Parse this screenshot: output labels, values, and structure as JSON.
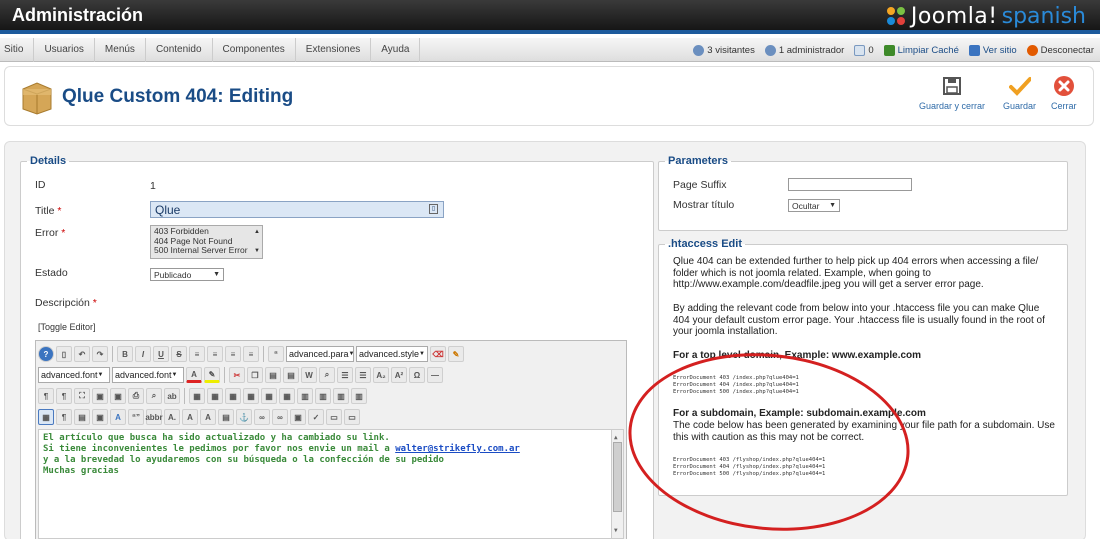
{
  "header": {
    "admin_title": "Administración",
    "logo_word": "Joomla!",
    "logo_sub": "spanish"
  },
  "menu": {
    "items": [
      "Sitio",
      "Usuarios",
      "Menús",
      "Contenido",
      "Componentes",
      "Extensiones",
      "Ayuda"
    ]
  },
  "status": {
    "visitors": "3 visitantes",
    "admins": "1 administrador",
    "messages": "0",
    "clear_cache": "Limpiar Caché",
    "view_site": "Ver sitio",
    "logout": "Desconectar"
  },
  "toolbar": {
    "page_title": "Qlue Custom 404: Editing",
    "save_close": "Guardar y cerrar",
    "save": "Guardar",
    "close": "Cerrar"
  },
  "details": {
    "legend": "Details",
    "id_label": "ID",
    "id_value": "1",
    "title_label": "Title",
    "title_value": "Qlue",
    "error_label": "Error",
    "error_options": [
      "403 Forbidden",
      "404 Page Not Found",
      "500 Internal Server Error"
    ],
    "estado_label": "Estado",
    "estado_value": "Publicado",
    "descripcion_label": "Descripción",
    "toggle_editor": "[Toggle Editor]",
    "required_mark": "*"
  },
  "editor": {
    "select_paragraph": "advanced.para",
    "select_style": "advanced.style",
    "select_font": "advanced.font",
    "select_fontsize": "advanced.font",
    "line1": "El artículo que busca ha sido actualizado y ha cambiado su link.",
    "line2_pre": "Si tiene inconvenientes le pedimos por favor nos envie un mail a ",
    "line2_link": "walter@strikefly.com.ar",
    "line3": "y a la brevedad lo ayudaremos con su búsqueda o la confección de su pedido",
    "line4": "Muchas gracias"
  },
  "parameters": {
    "legend": "Parameters",
    "suffix_label": "Page Suffix",
    "suffix_value": "",
    "show_title_label": "Mostrar título",
    "show_title_value": "Ocultar"
  },
  "htaccess": {
    "legend": ".htaccess Edit",
    "p1": "Qlue 404 can be extended further to help pick up 404 errors when accessing a file/ folder which is not joomla related. Example, when going to http://www.example.com/deadfile.jpeg you will get a server error page.",
    "p2": "By adding the relevant code from below into your .htaccess file you can make Qlue 404 your default custom error page. Your .htaccess file is usually found in the root of your joomla installation.",
    "h1": "For a top level domain, Example: www.example.com",
    "code1": [
      "ErrorDocument 403 /index.php?qlue404=1",
      "ErrorDocument 404 /index.php?qlue404=1",
      "ErrorDocument 500 /index.php?qlue404=1"
    ],
    "h2": "For a subdomain, Example: subdomain.example.com",
    "p3": "The code below has been generated by examining your file path for a subdomain. Use this with caution as this may not be correct.",
    "code2": [
      "ErrorDocument 403 /flyshop/index.php?qlue404=1",
      "ErrorDocument 404 /flyshop/index.php?qlue404=1",
      "ErrorDocument 500 /flyshop/index.php?qlue404=1"
    ]
  },
  "colors": {
    "accent": "#1a4c86",
    "annotation": "#d42020",
    "editor_text": "#3a8a3a"
  }
}
